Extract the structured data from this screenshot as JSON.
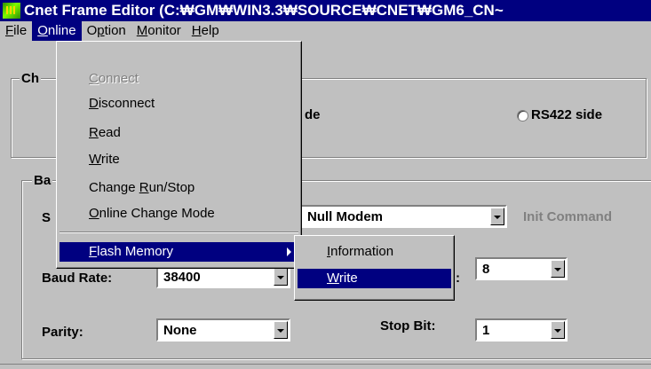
{
  "window": {
    "title": "Cnet Frame Editor (C:₩GM₩WIN3.3₩SOURCE₩CNET₩GM6_CN~"
  },
  "menubar": {
    "file": {
      "first": "F",
      "rest": "ile"
    },
    "online": {
      "first": "O",
      "rest": "nline"
    },
    "option": {
      "first": "O",
      "mid": "p",
      "rest": "tion"
    },
    "monitor": {
      "first": "M",
      "rest": "onitor"
    },
    "help": {
      "first": "H",
      "rest": "elp"
    }
  },
  "online_menu": {
    "connect": {
      "first": "C",
      "rest": "onnect"
    },
    "disconnect": {
      "first": "D",
      "rest": "isconnect"
    },
    "read": {
      "first": "R",
      "rest": "ead"
    },
    "write": {
      "first": "W",
      "rest": "rite"
    },
    "change_run_stop": {
      "pre": "Change ",
      "u": "R",
      "post": "un/Stop"
    },
    "online_change_mode": {
      "first": "O",
      "rest": "nline Change Mode"
    },
    "flash_memory": {
      "first": "F",
      "rest": "lash Memory"
    }
  },
  "flash_submenu": {
    "information": {
      "first": "I",
      "rest": "nformation"
    },
    "write": {
      "first": "W",
      "rest": "rite"
    }
  },
  "channel_group": {
    "label_visible": "Ch",
    "side_visible": "de",
    "rs422_label": "RS422 side"
  },
  "basic_group": {
    "label_visible": "Ba",
    "station_label_visible": "S",
    "init_command": "Init Command"
  },
  "fields": {
    "modem_type": "Null Modem",
    "baud_rate_label": "Baud Rate:",
    "baud_rate_value": "38400",
    "data_bit_visible_label": ":",
    "data_bit_value": "8",
    "parity_label": "Parity:",
    "parity_value": "None",
    "stop_bit_label": "Stop Bit:",
    "stop_bit_value": "1"
  },
  "colors": {
    "title_bg": "#000080",
    "face": "#c0c0c0",
    "highlight": "#000080",
    "disabled": "#808080"
  },
  "icons": [
    "app-icon",
    "radio-icon",
    "dropdown-arrow-icon",
    "submenu-arrow-icon"
  ]
}
